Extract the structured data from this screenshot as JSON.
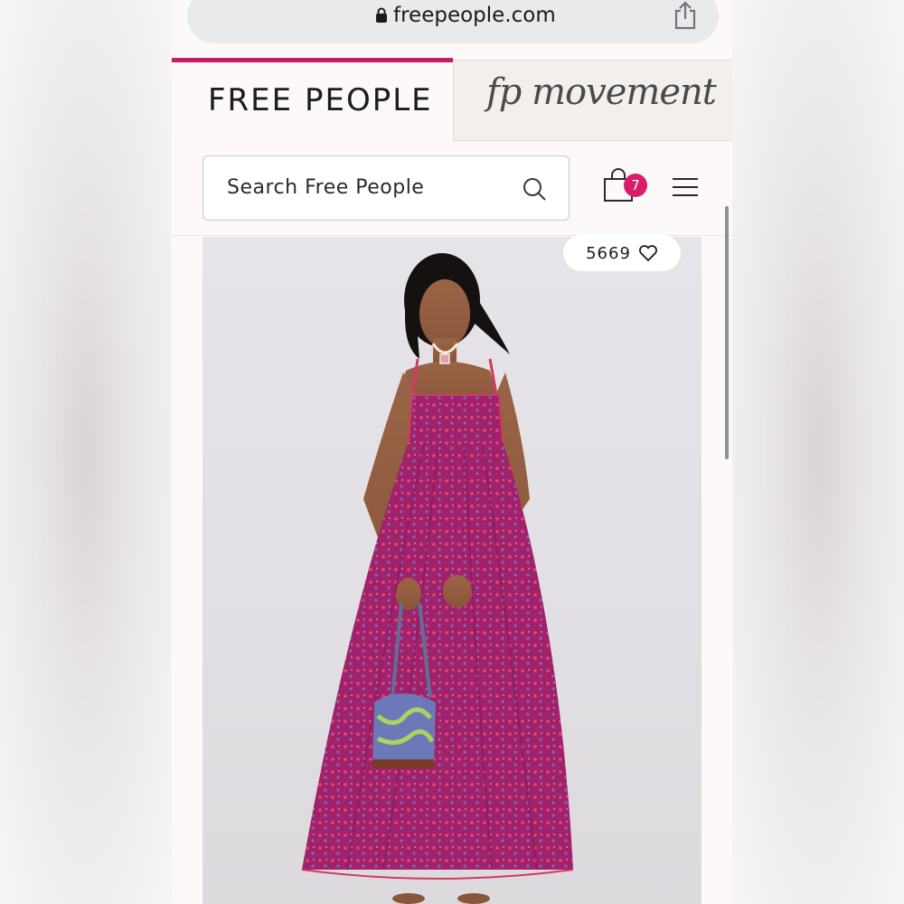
{
  "browser": {
    "url": "freepeople.com"
  },
  "brand_tabs": {
    "primary": "FREE PEOPLE",
    "secondary": "fp movement"
  },
  "search": {
    "placeholder": "Search Free People"
  },
  "cart": {
    "count": "7"
  },
  "product": {
    "like_count": "5669"
  },
  "colors": {
    "accent": "#c41e62",
    "badge": "#d81e6a",
    "dress": "#a8246c"
  },
  "icons": [
    "lock-icon",
    "share-icon",
    "search-icon",
    "shopping-bag-icon",
    "menu-icon",
    "heart-icon"
  ]
}
